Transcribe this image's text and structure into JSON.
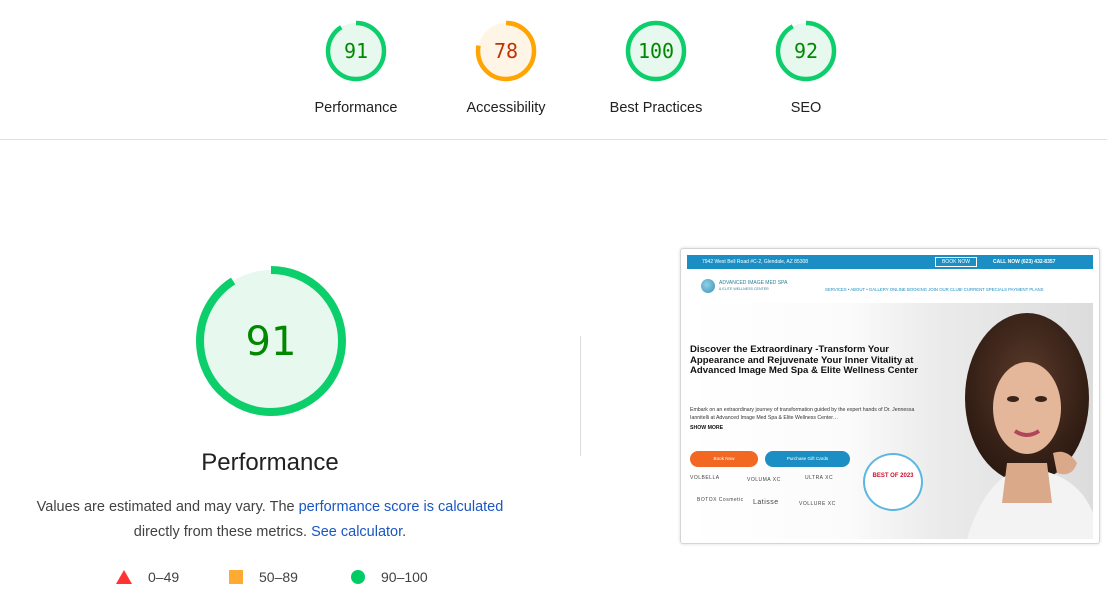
{
  "scores": [
    {
      "value": "91",
      "label": "Performance",
      "color": "#0cce6b",
      "fill": "#e7f8ee",
      "text_color": "#008800",
      "fraction": 0.91
    },
    {
      "value": "78",
      "label": "Accessibility",
      "color": "#ffa400",
      "fill": "#fff5e6",
      "text_color": "#c33300",
      "fraction": 0.78
    },
    {
      "value": "100",
      "label": "Best Practices",
      "color": "#0cce6b",
      "fill": "#e7f8ee",
      "text_color": "#008800",
      "fraction": 1.0
    },
    {
      "value": "92",
      "label": "SEO",
      "color": "#0cce6b",
      "fill": "#e7f8ee",
      "text_color": "#008800",
      "fraction": 0.92
    }
  ],
  "performance": {
    "score": "91",
    "fraction": 0.91,
    "title": "Performance",
    "desc_prefix": "Values are estimated and may vary. The ",
    "desc_link": "performance score is calculated",
    "desc_middle": " directly from these metrics. ",
    "calc_link": "See calculator",
    "desc_suffix": "."
  },
  "legend": [
    {
      "range": "0–49",
      "shape": "triangle",
      "color": "#ff3333"
    },
    {
      "range": "50–89",
      "shape": "square",
      "color": "#ffaa33"
    },
    {
      "range": "90–100",
      "shape": "circle",
      "color": "#00cc66"
    }
  ],
  "screenshot": {
    "address": "7942 West Bell Road #C-2, Glendale, AZ 85308",
    "book_now": "BOOK NOW",
    "call_now": "CALL NOW (623) 432-8357",
    "logo_line1": "ADVANCED IMAGE MED SPA",
    "logo_line2": "& ELITE WELLNESS CENTER",
    "menu": "SERVICES  •  ABOUT  •  GALLERY  ONLINE BOOKING  JOIN OUR CLUB!  CURRENT SPECIALS  PAYMENT PLANS",
    "headline": "Discover the Extraordinary -Transform Your Appearance and Rejuvenate Your Inner Vitality at Advanced Image Med Spa & Elite Wellness Center",
    "subtext": "Embark on an extraordinary journey of transformation guided by the expert hands of Dr. Jennessa Iannitelli at Advanced Image Med Spa & Elite Wellness Center…",
    "show_more": "SHOW MORE",
    "btn_book": "Book Now",
    "btn_gift": "Purchase Gift Cards",
    "brands": [
      "VOLBELLA",
      "VOLUMA XC",
      "ULTRA XC",
      "BOTOX Cosmetic",
      "Latisse",
      "VOLLURE XC"
    ],
    "badge": "BEST OF 2023"
  }
}
